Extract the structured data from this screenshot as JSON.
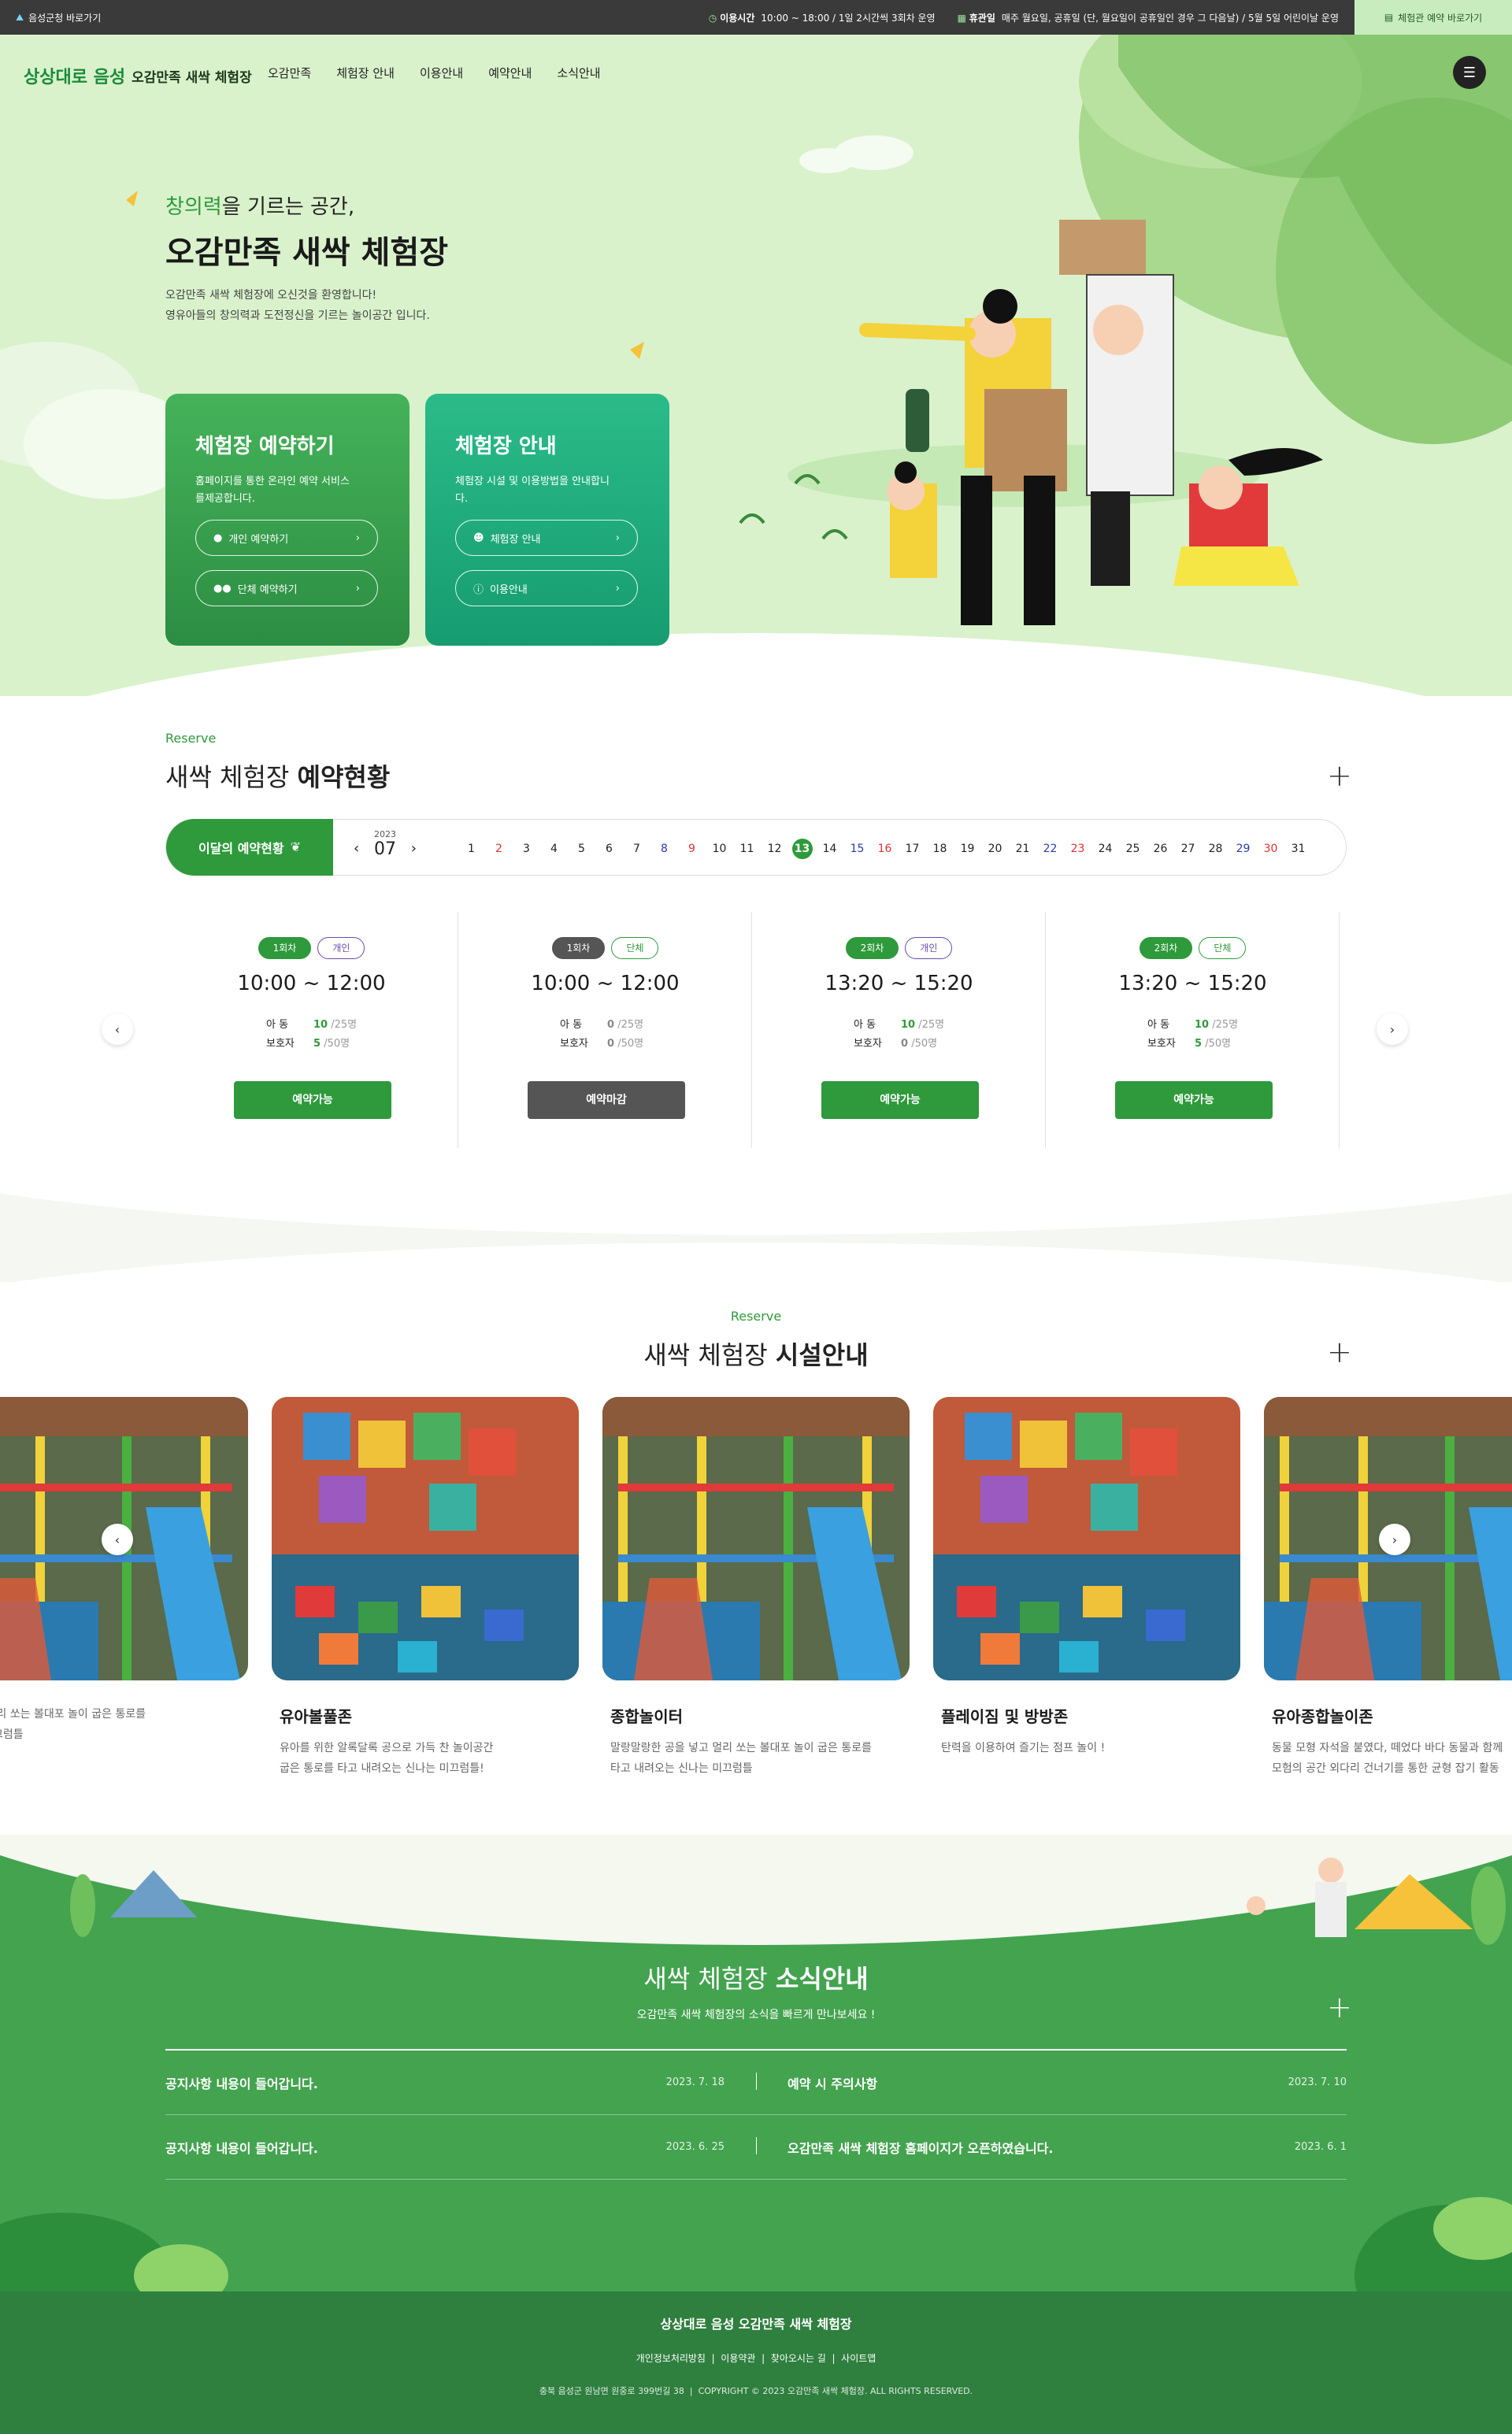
{
  "topbar": {
    "left_link": "음성군청 바로가기",
    "hours_label": "이용시간",
    "hours_value": "10:00 ~ 18:00 / 1일 2시간씩 3회차 운영",
    "closed_label": "휴관일",
    "closed_value": "매주 월요일, 공휴일 (단, 월요일이 공휴일인 경우 그 다음날) / 5월 5일 어린이날 운영",
    "right_button": "체험관 예약 바로가기"
  },
  "header": {
    "logo_brand": "상상대로 음성",
    "logo_text": "오감만족 새싹 체험장",
    "nav": [
      "오감만족",
      "체험장 안내",
      "이용안내",
      "예약안내",
      "소식안내"
    ]
  },
  "hero": {
    "subtitle_em": "창의력",
    "subtitle_rest": "을 기르는 공간,",
    "title": "오감만족 새싹 체험장",
    "desc_line1": "오감만족 새싹 체험장에 오신것을 환영합니다!",
    "desc_line2": "영유아들의 창의력과 도전정신을 기르는 놀이공간 입니다.",
    "card1": {
      "title": "체험장 예약하기",
      "desc": "홈페이지를 통한 온라인 예약 서비스를제공합니다.",
      "btn1": "개인 예약하기",
      "btn2": "단체 예약하기"
    },
    "card2": {
      "title": "체험장 안내",
      "desc": "체험장 시설 및 이용방법을 안내합니다.",
      "btn1": "체험장 안내",
      "btn2": "이용안내"
    }
  },
  "reserve": {
    "label": "Reserve",
    "title_plain": "새싹 체험장",
    "title_bold": "예약현황",
    "month_button": "이달의 예약현황",
    "year": "2023",
    "month": "07",
    "today": 13,
    "days": [
      {
        "n": "1",
        "c": "#222"
      },
      {
        "n": "2",
        "c": "#e0303a"
      },
      {
        "n": "3",
        "c": "#222"
      },
      {
        "n": "4",
        "c": "#222"
      },
      {
        "n": "5",
        "c": "#222"
      },
      {
        "n": "6",
        "c": "#222"
      },
      {
        "n": "7",
        "c": "#222"
      },
      {
        "n": "8",
        "c": "#2a3aa8"
      },
      {
        "n": "9",
        "c": "#e0303a"
      },
      {
        "n": "10",
        "c": "#222"
      },
      {
        "n": "11",
        "c": "#222"
      },
      {
        "n": "12",
        "c": "#222"
      },
      {
        "n": "13",
        "c": "#fff"
      },
      {
        "n": "14",
        "c": "#222"
      },
      {
        "n": "15",
        "c": "#2a3aa8"
      },
      {
        "n": "16",
        "c": "#e0303a"
      },
      {
        "n": "17",
        "c": "#222"
      },
      {
        "n": "18",
        "c": "#222"
      },
      {
        "n": "19",
        "c": "#222"
      },
      {
        "n": "20",
        "c": "#222"
      },
      {
        "n": "21",
        "c": "#222"
      },
      {
        "n": "22",
        "c": "#2a3aa8"
      },
      {
        "n": "23",
        "c": "#e0303a"
      },
      {
        "n": "24",
        "c": "#222"
      },
      {
        "n": "25",
        "c": "#222"
      },
      {
        "n": "26",
        "c": "#222"
      },
      {
        "n": "27",
        "c": "#222"
      },
      {
        "n": "28",
        "c": "#222"
      },
      {
        "n": "29",
        "c": "#2a3aa8"
      },
      {
        "n": "30",
        "c": "#e0303a"
      },
      {
        "n": "31",
        "c": "#222"
      }
    ],
    "sessions": [
      {
        "round": "1회차",
        "type": "개인",
        "time": "10:00 ~ 12:00",
        "child_label": "아 동",
        "child": "10",
        "child_max": "/25명",
        "guard_label": "보호자",
        "guard": "5",
        "guard_max": "/50명",
        "btn": "예약가능",
        "open": true
      },
      {
        "round": "1회차",
        "type": "단체",
        "time": "10:00 ~ 12:00",
        "child_label": "아 동",
        "child": "0",
        "child_max": "/25명",
        "guard_label": "보호자",
        "guard": "0",
        "guard_max": "/50명",
        "btn": "예약마감",
        "open": false
      },
      {
        "round": "2회차",
        "type": "개인",
        "time": "13:20 ~ 15:20",
        "child_label": "아 동",
        "child": "10",
        "child_max": "/25명",
        "guard_label": "보호자",
        "guard": "0",
        "guard_max": "/50명",
        "btn": "예약가능",
        "open": true
      },
      {
        "round": "2회차",
        "type": "단체",
        "time": "13:20 ~ 15:20",
        "child_label": "아 동",
        "child": "10",
        "child_max": "/25명",
        "guard_label": "보호자",
        "guard": "5",
        "guard_max": "/50명",
        "btn": "예약가능",
        "open": true
      }
    ]
  },
  "facility": {
    "label": "Reserve",
    "title_plain": "새싹 체험장",
    "title_bold": "시설안내",
    "items": [
      {
        "name": "",
        "line1": "을 넣고 멀리 쏘는 볼대포 놀이 굽은 통로를",
        "line2": "신나는 미끄럼틀"
      },
      {
        "name": "유아볼풀존",
        "line1": "유아를 위한 알록달록 공으로 가득 찬 놀이공간",
        "line2": "굽은 통로를 타고 내려오는 신나는 미끄럼틀!"
      },
      {
        "name": "종합놀이터",
        "line1": "말랑말랑한 공을 넣고 멀리 쏘는 볼대포 놀이 굽은 통로를",
        "line2": "타고 내려오는 신나는 미끄럼틀"
      },
      {
        "name": "플레이짐 및 방방존",
        "line1": "탄력을 이용하여 즐기는 점프 놀이 !",
        "line2": ""
      },
      {
        "name": "유아종합놀이존",
        "line1": "동물 모형 자석을 붙였다, 떼었다 바다 동물과 함께",
        "line2": "모험의 공간 외다리 건너기를 통한 균형 잡기 활동"
      }
    ]
  },
  "news": {
    "title_plain": "새싹 체험장",
    "title_bold": "소식안내",
    "subtitle": "오감만족 새싹 체험장의 소식을 빠르게 만나보세요 !",
    "items": [
      {
        "title": "공지사항 내용이 들어갑니다.",
        "date": "2023. 7. 18"
      },
      {
        "title": "예약 시 주의사항",
        "date": "2023. 7. 10"
      },
      {
        "title": "공지사항 내용이 들어갑니다.",
        "date": "2023. 6. 25"
      },
      {
        "title": "오감만족 새싹 체험장 홈페이지가 오픈하였습니다.",
        "date": "2023. 6. 1"
      }
    ]
  },
  "footer": {
    "logo_brand": "상상대로 음성",
    "logo_text": "오감만족 새싹 체험장",
    "links": [
      "개인정보처리방침",
      "이용약관",
      "찾아오시는 길",
      "사이트맵"
    ],
    "address": "충북 음성군 원남면 원중로 399번길 38",
    "copyright": "COPYRIGHT © 2023 오감만족 새싹 체험장. ALL RIGHTS RESERVED."
  },
  "colors": {
    "primary": "#2e9a3b",
    "teal": "#169c70",
    "dark": "#3a3a3a",
    "closed": "#555555"
  }
}
